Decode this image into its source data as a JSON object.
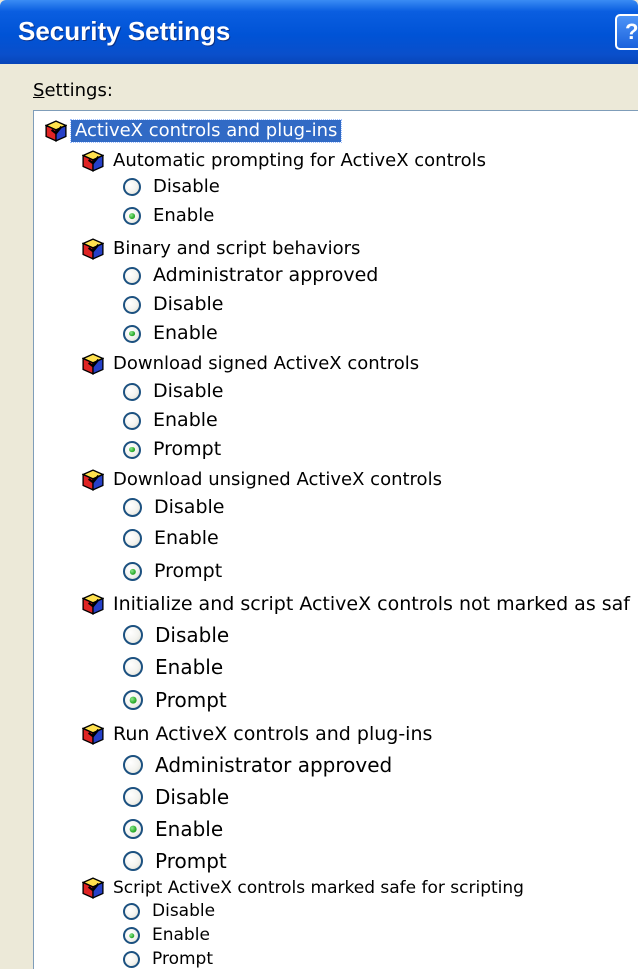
{
  "window": {
    "title": "Security Settings",
    "help_label": "?",
    "colors": {
      "titlebar": "#0a5ee0",
      "selection": "#316ac5",
      "radio_checked": "#33b233",
      "dialog_bg": "#ece9d8"
    }
  },
  "settings_label": {
    "accel": "S",
    "rest": "ettings:"
  },
  "tree": {
    "category": {
      "label": "ActiveX controls and plug-ins",
      "icon": "security-setting-cube-icon",
      "selected": true
    },
    "settings": [
      {
        "label": "Automatic prompting for ActiveX controls",
        "icon": "security-setting-cube-icon",
        "options": [
          {
            "label": "Disable",
            "checked": false
          },
          {
            "label": "Enable",
            "checked": true
          }
        ]
      },
      {
        "label": "Binary and script behaviors",
        "icon": "security-setting-cube-icon",
        "options": [
          {
            "label": "Administrator approved",
            "checked": false
          },
          {
            "label": "Disable",
            "checked": false
          },
          {
            "label": "Enable",
            "checked": true
          }
        ]
      },
      {
        "label": "Download signed ActiveX controls",
        "icon": "security-setting-cube-icon",
        "options": [
          {
            "label": "Disable",
            "checked": false
          },
          {
            "label": "Enable",
            "checked": false
          },
          {
            "label": "Prompt",
            "checked": true
          }
        ]
      },
      {
        "label": "Download unsigned ActiveX controls",
        "icon": "security-setting-cube-icon",
        "options": [
          {
            "label": "Disable",
            "checked": false
          },
          {
            "label": "Enable",
            "checked": false
          },
          {
            "label": "Prompt",
            "checked": true
          }
        ]
      },
      {
        "label": "Initialize and script ActiveX controls not marked as saf",
        "icon": "security-setting-cube-icon",
        "options": [
          {
            "label": "Disable",
            "checked": false
          },
          {
            "label": "Enable",
            "checked": false
          },
          {
            "label": "Prompt",
            "checked": true
          }
        ]
      },
      {
        "label": "Run ActiveX controls and plug-ins",
        "icon": "security-setting-cube-icon",
        "options": [
          {
            "label": "Administrator approved",
            "checked": false
          },
          {
            "label": "Disable",
            "checked": false
          },
          {
            "label": "Enable",
            "checked": true
          },
          {
            "label": "Prompt",
            "checked": false
          }
        ]
      },
      {
        "label": "Script ActiveX controls marked safe for scripting",
        "icon": "security-setting-cube-icon",
        "options": [
          {
            "label": "Disable",
            "checked": false
          },
          {
            "label": "Enable",
            "checked": true
          },
          {
            "label": "Prompt",
            "checked": false
          }
        ]
      }
    ]
  }
}
